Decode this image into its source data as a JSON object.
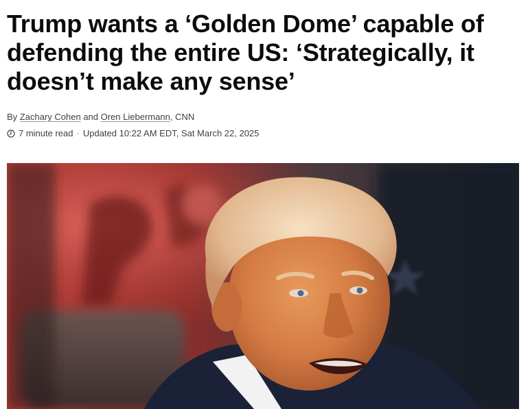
{
  "article": {
    "headline": "Trump wants a ‘Golden Dome’ capable of defending the entire US: ‘Strategically, it doesn’t make any sense’",
    "byline": {
      "prefix": "By",
      "author1": "Zachary Cohen",
      "conjunction": "and",
      "author2": "Oren Liebermann",
      "source": ", CNN"
    },
    "meta": {
      "read_time": "7 minute read",
      "separator": "·",
      "updated": "Updated 10:22 AM EDT, Sat March 22, 2025"
    },
    "icons": {
      "clock": "clock-icon"
    }
  },
  "colors": {
    "text": "#0c0c0c",
    "meta_text": "#404040"
  }
}
